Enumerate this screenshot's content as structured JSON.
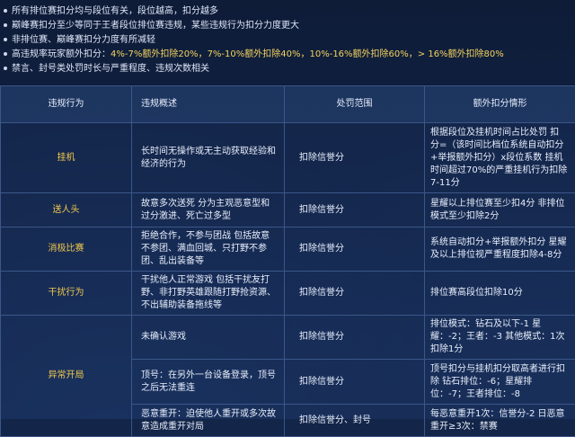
{
  "notes": [
    {
      "text": "所有排位赛扣分均与段位有关，段位越高，扣分越多"
    },
    {
      "text": "巅峰赛扣分至少等同于王者段位排位赛违规，某些违规行为扣分力度更大"
    },
    {
      "text": "非排位赛、巅峰赛扣分力度有所减轻"
    },
    {
      "text": "高违规率玩家额外扣分：",
      "highlight": "4%-7%额外扣除20%，7%-10%额外扣除40%，10%-16%额外扣除60%，> 16%额外扣除80%"
    },
    {
      "text": "禁言、封号类处罚时长与严重程度、违规次数相关"
    }
  ],
  "table": {
    "headers": [
      "违规行为",
      "违规概述",
      "处罚范围",
      "额外扣分情形"
    ],
    "rows": [
      {
        "category": "挂机",
        "desc": "长时间无操作或无主动获取经验和经济的行为",
        "penalty": "扣除信誉分",
        "extra": "根据段位及挂机时间占比处罚 扣分=（该时间比档位系统自动扣分+举报额外扣分）x段位系数 挂机时间超过70%的严重挂机行为扣除7-11分"
      },
      {
        "category": "送人头",
        "desc": "故意多次送死 分为主观恶意型和过分激进、死亡过多型",
        "penalty": "扣除信誉分",
        "extra": "星耀以上排位赛至少扣4分 非排位模式至少扣除2分"
      },
      {
        "category": "消极比赛",
        "desc": "拒绝合作，不参与团战 包括故意不参团、满血回城、只打野不参团、乱出装备等",
        "penalty": "扣除信誉分",
        "extra": "系统自动扣分+举报额外扣分 星耀及以上排位视严重程度扣除4-8分"
      },
      {
        "category": "干扰行为",
        "desc": "干扰他人正常游戏 包括干扰友打野、非打野英雄跟随打野抢资源、不出辅助装备拖线等",
        "penalty": "扣除信誉分",
        "extra": "排位赛高段位扣除10分"
      },
      {
        "category": "异常开局",
        "desc": "未确认游戏",
        "penalty": "扣除信誉分",
        "extra": "排位模式：钻石及以下-1 星耀：-2；王者：-3 其他模式：1次扣除1分"
      },
      {
        "category": "",
        "desc": "顶号：在另外一台设备登录，顶号之后无法重连",
        "penalty": "扣除信誉分",
        "extra": "顶号扣分与挂机扣分取高者进行扣除 钻石排位：-6；星耀排位：-7；王者排位：-8"
      },
      {
        "category": "",
        "desc": "恶意重开：迫使他人重开或多次故意造成重开对局",
        "penalty": "扣除信誉分、封号",
        "extra": "每恶意重开1次：信誉分-2 日恶意重开≥3次：禁赛"
      }
    ]
  }
}
